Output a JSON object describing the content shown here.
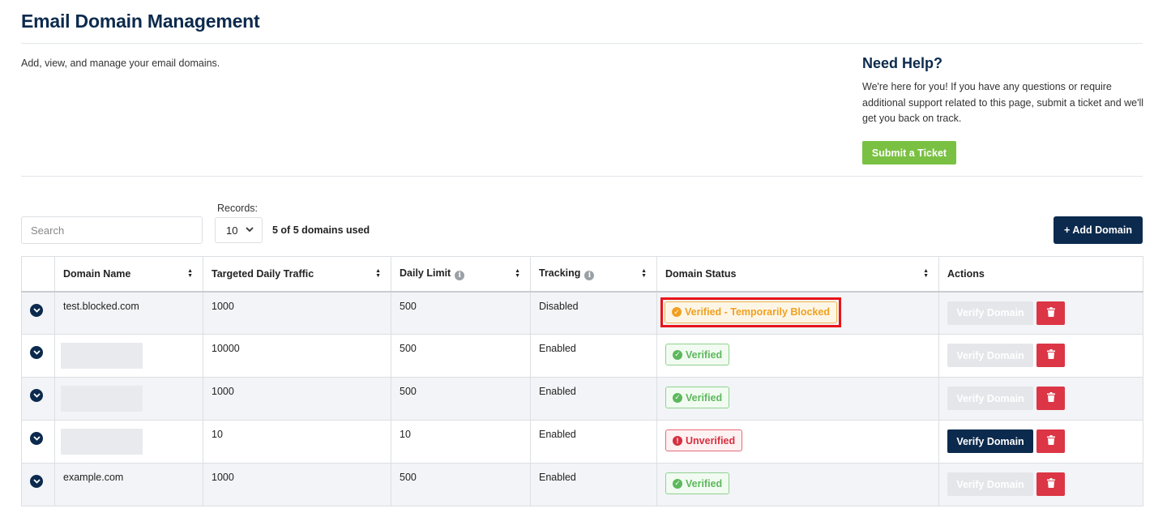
{
  "header": {
    "title": "Email Domain Management",
    "description": "Add, view, and manage your email domains."
  },
  "help": {
    "title": "Need Help?",
    "text": "We're here for you! If you have any questions or require additional support related to this page, submit a ticket and we'll get you back on track.",
    "button_label": "Submit a Ticket"
  },
  "toolbar": {
    "search_placeholder": "Search",
    "records_label": "Records:",
    "records_value": "10",
    "domains_used": "5 of 5 domains used",
    "add_button_label": "+ Add Domain"
  },
  "table": {
    "columns": [
      "Domain Name",
      "Targeted Daily Traffic",
      "Daily Limit",
      "Tracking",
      "Domain Status",
      "Actions"
    ],
    "rows": [
      {
        "domain": "test.blocked.com",
        "traffic": "1000",
        "limit": "500",
        "tracking": "Disabled",
        "status": "Verified - Temporarily Blocked",
        "status_type": "blocked",
        "verify_label": "Verify Domain",
        "verify_enabled": false
      },
      {
        "domain": "",
        "traffic": "10000",
        "limit": "500",
        "tracking": "Enabled",
        "status": "Verified",
        "status_type": "verified",
        "verify_label": "Verify Domain",
        "verify_enabled": false
      },
      {
        "domain": "",
        "traffic": "1000",
        "limit": "500",
        "tracking": "Enabled",
        "status": "Verified",
        "status_type": "verified",
        "verify_label": "Verify Domain",
        "verify_enabled": false
      },
      {
        "domain": "",
        "traffic": "10",
        "limit": "10",
        "tracking": "Enabled",
        "status": "Unverified",
        "status_type": "unverified",
        "verify_label": "Verify Domain",
        "verify_enabled": true
      },
      {
        "domain": "example.com",
        "traffic": "1000",
        "limit": "500",
        "tracking": "Enabled",
        "status": "Verified",
        "status_type": "verified",
        "verify_label": "Verify Domain",
        "verify_enabled": false
      }
    ]
  },
  "colors": {
    "brand_navy": "#0c2a4d",
    "help_button_green": "#7ac143",
    "verified_green": "#5cb85c",
    "blocked_orange": "#f0a020",
    "unverified_red": "#d6303f",
    "delete_red": "#dc3545",
    "highlight_red": "#e8141b"
  }
}
